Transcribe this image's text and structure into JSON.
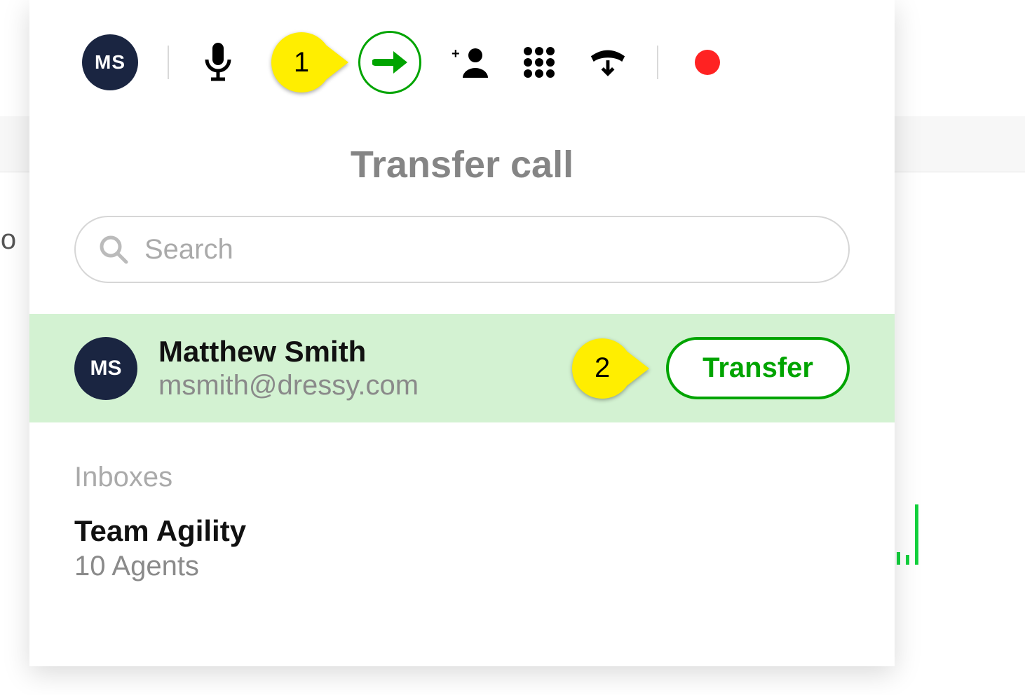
{
  "toolbar": {
    "avatar_initials": "MS",
    "annotation1": "1"
  },
  "title": "Transfer call",
  "search": {
    "placeholder": "Search",
    "value": ""
  },
  "contact": {
    "avatar_initials": "MS",
    "name": "Matthew Smith",
    "email": "msmith@dressy.com",
    "annotation2": "2",
    "transfer_label": "Transfer"
  },
  "sections": {
    "inboxes_label": "Inboxes"
  },
  "inboxes": [
    {
      "name": "Team Agility",
      "subtitle": "10 Agents"
    }
  ],
  "bg_fragment": "jo"
}
